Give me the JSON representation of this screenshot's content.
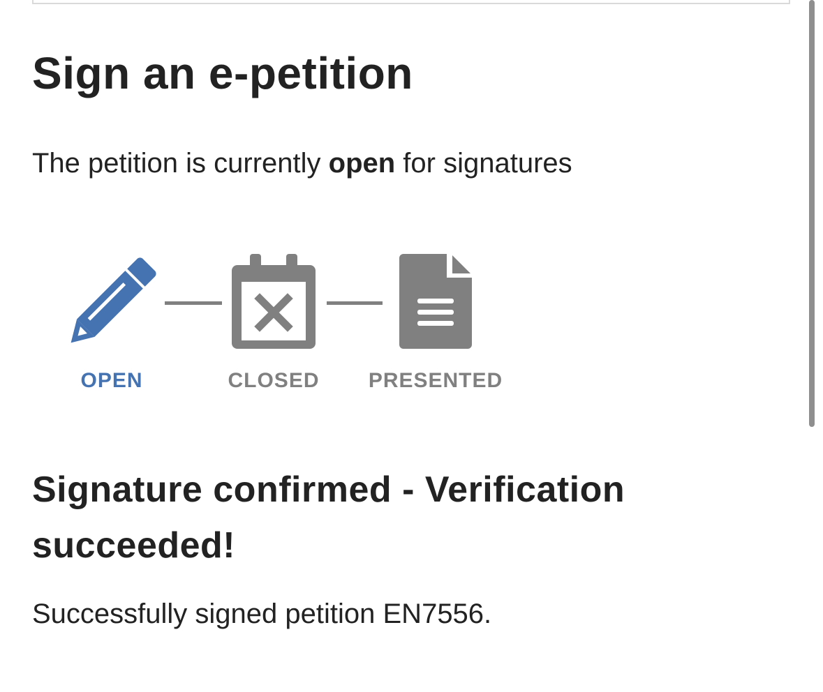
{
  "page": {
    "title": "Sign an e-petition",
    "status": {
      "prefix": "The petition is currently ",
      "state": "open",
      "suffix": " for signatures"
    }
  },
  "stages": [
    {
      "label": "OPEN",
      "icon": "pencil-icon",
      "active": true
    },
    {
      "label": "CLOSED",
      "icon": "calendar-x-icon",
      "active": false
    },
    {
      "label": "PRESENTED",
      "icon": "document-icon",
      "active": false
    }
  ],
  "colors": {
    "active": "#4573b1",
    "inactive": "#808080",
    "text": "#222222"
  },
  "confirmation": {
    "heading": "Signature confirmed - Verification succeeded!",
    "message": "Successfully signed petition EN7556."
  }
}
